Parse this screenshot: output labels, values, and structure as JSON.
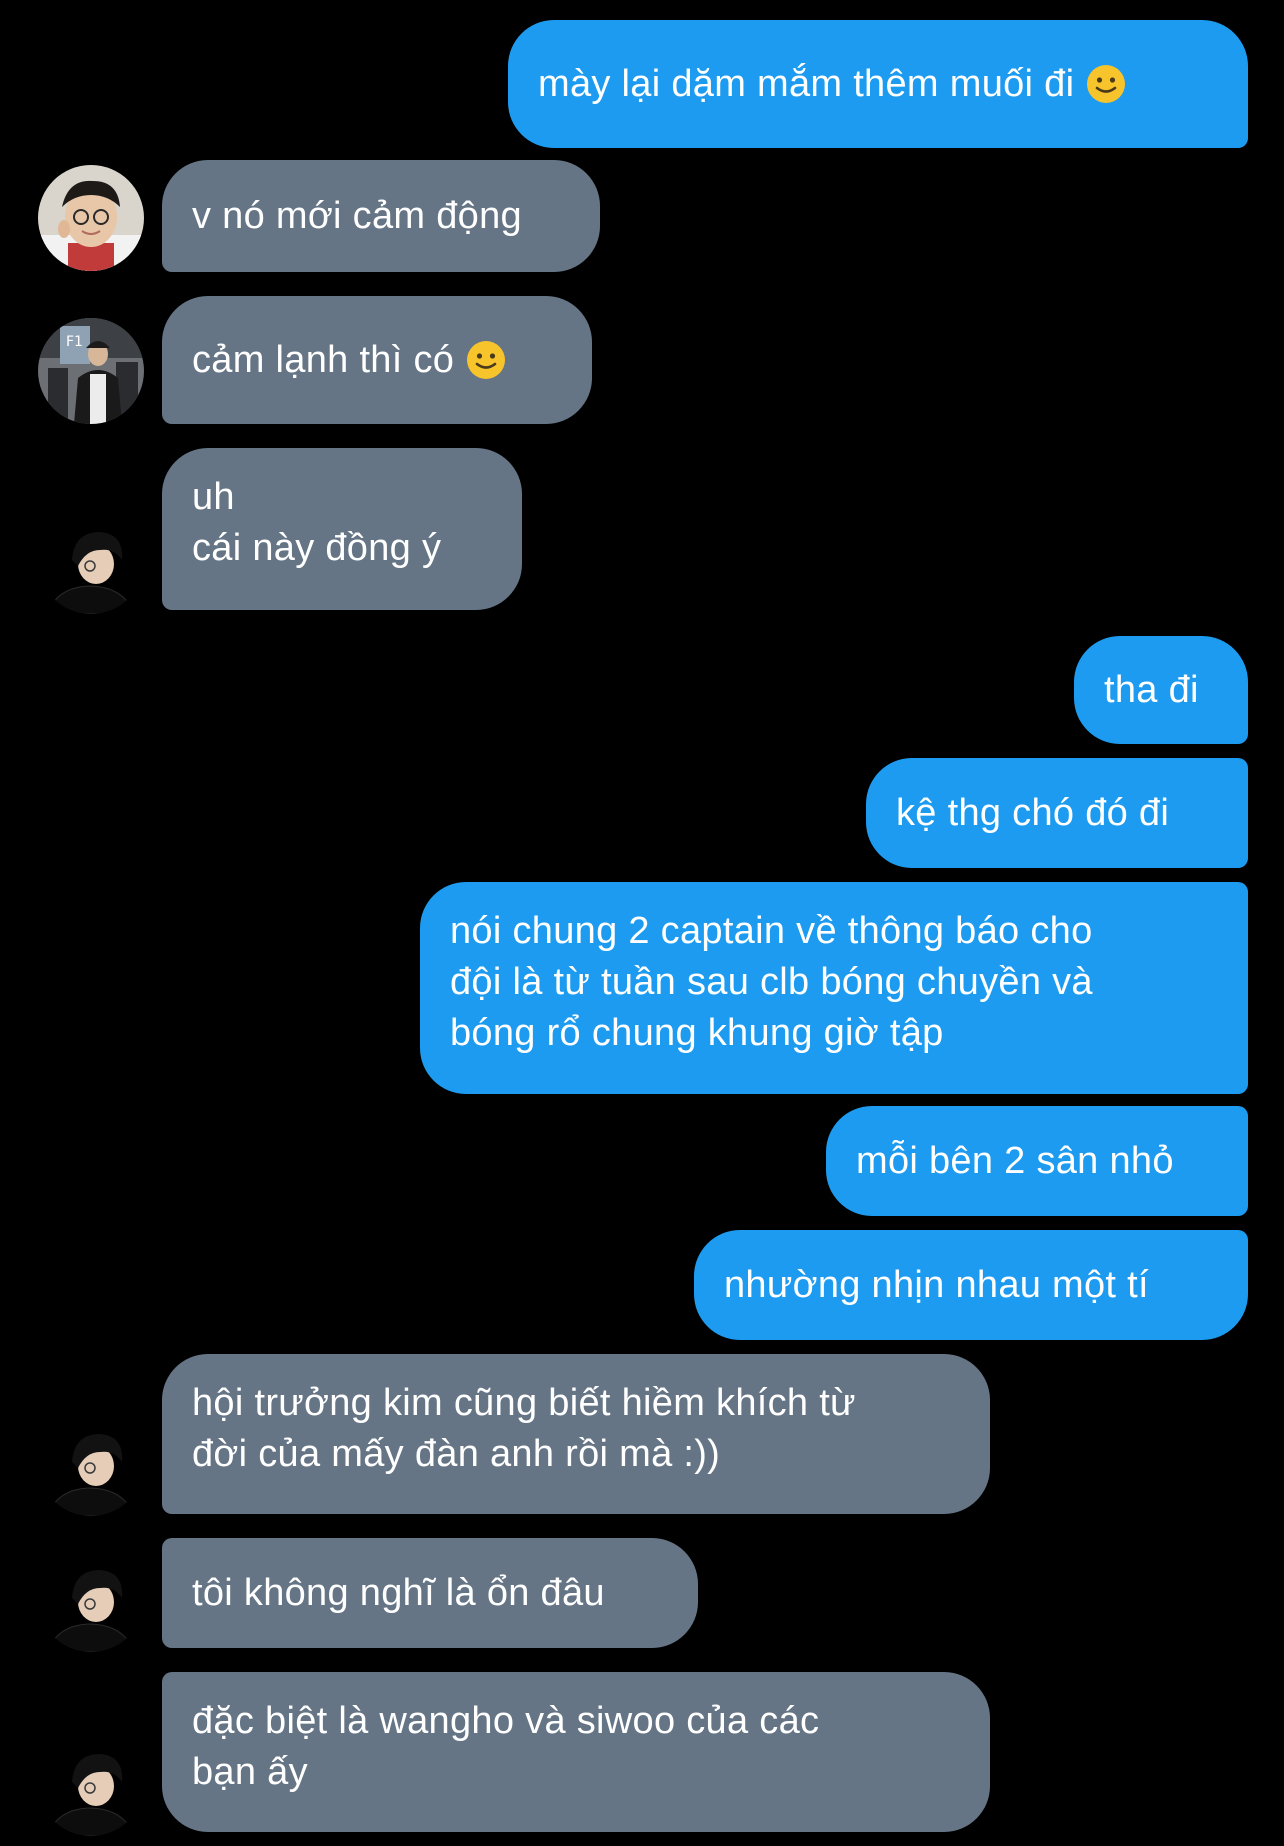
{
  "colors": {
    "background": "#000000",
    "sent_bubble": "#1d9bf0",
    "received_bubble": "#657585",
    "text": "#ffffff"
  },
  "messages": [
    {
      "id": "m1",
      "sender": "me",
      "text": "mày lại dặm mắm thêm muối đi",
      "emoji": "slightly-smiling-face"
    },
    {
      "id": "m2",
      "sender": "other",
      "avatar": "avatar-photo-glasses",
      "text": "v nó mới cảm động"
    },
    {
      "id": "m3",
      "sender": "other",
      "avatar": "avatar-photo-f1",
      "text": "cảm lạnh thì có",
      "emoji": "slightly-smiling-face"
    },
    {
      "id": "m4",
      "sender": "other",
      "avatar": "avatar-photo-profile",
      "lines": [
        "uh",
        "cái này đồng ý"
      ]
    },
    {
      "id": "m5",
      "sender": "me",
      "text": "tha đi"
    },
    {
      "id": "m6",
      "sender": "me",
      "text": "kệ thg chó đó đi"
    },
    {
      "id": "m7",
      "sender": "me",
      "lines": [
        "nói chung 2 captain về thông báo cho",
        "đội là từ tuần sau clb bóng chuyền và",
        "bóng rổ chung khung giờ tập"
      ]
    },
    {
      "id": "m8",
      "sender": "me",
      "text": "mỗi bên 2 sân nhỏ"
    },
    {
      "id": "m9",
      "sender": "me",
      "text": "nhường nhịn nhau một tí"
    },
    {
      "id": "m10",
      "sender": "other",
      "avatar": "avatar-photo-profile",
      "lines": [
        "hội trưởng kim cũng biết hiềm khích từ",
        "đời của mấy đàn anh rồi mà :))"
      ]
    },
    {
      "id": "m11",
      "sender": "other",
      "avatar": "avatar-photo-profile",
      "text": "tôi không nghĩ là ổn đâu"
    },
    {
      "id": "m12",
      "sender": "other",
      "avatar": "avatar-photo-profile",
      "lines": [
        "đặc biệt là wangho và siwoo của các",
        "bạn ấy"
      ]
    }
  ]
}
